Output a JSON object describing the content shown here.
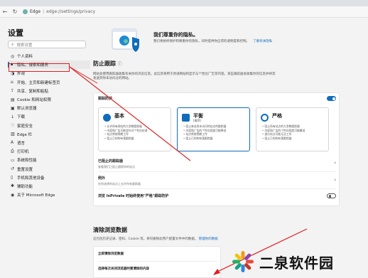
{
  "browser": {
    "brand": "Edge",
    "url": "edge://settings/privacy",
    "icons": [
      "back-icon",
      "refresh-icon",
      "edge-icon"
    ]
  },
  "sidebar": {
    "title": "设置",
    "search_placeholder": "搜索设置",
    "items": [
      {
        "label": "个人资料",
        "icon": "profile-icon"
      },
      {
        "label": "隐私、搜索和服务",
        "icon": "lock-icon",
        "active": true
      },
      {
        "label": "外观",
        "icon": "appearance-icon"
      },
      {
        "label": "开始、主页和新建标签页",
        "icon": "home-icon"
      },
      {
        "label": "共享、复制和粘贴",
        "icon": "share-icon"
      },
      {
        "label": "Cookie 和网站权限",
        "icon": "cookie-icon"
      },
      {
        "label": "默认浏览器",
        "icon": "browser-icon"
      },
      {
        "label": "下载",
        "icon": "download-icon"
      },
      {
        "label": "家庭安全",
        "icon": "family-icon"
      },
      {
        "label": "Edge 栏",
        "icon": "sidebar-icon"
      },
      {
        "label": "语言",
        "icon": "language-icon"
      },
      {
        "label": "打印机",
        "icon": "printer-icon"
      },
      {
        "label": "系统和性能",
        "icon": "system-icon"
      },
      {
        "label": "重置设置",
        "icon": "reset-icon"
      },
      {
        "label": "手机和其他设备",
        "icon": "phone-icon"
      },
      {
        "label": "辅助功能",
        "icon": "accessibility-icon"
      },
      {
        "label": "关于 Microsoft Edge",
        "icon": "edge-about-icon"
      }
    ]
  },
  "hero": {
    "title": "我们尊重你的隐私。",
    "subtitle": "我们将始终保护和尊重你的隐私，同时提供你应得的透明度和控制。",
    "link": "了解有关隐私"
  },
  "tracking": {
    "title": "防止跟踪",
    "description_line1": "网站会使用跟踪器收集有关你的浏览信息。此信息将用于改进网站和显示与个性化广告等内容。某些跟踪器会收集你的信息并将其",
    "description_line2": "发送到你未访问过的网站。",
    "toggle_label": "跟踪防护",
    "toggle_on": true,
    "cards": [
      {
        "name": "基本",
        "sub": "",
        "selected": false,
        "color": "#0f6cbd",
        "bullets": [
          "允许所有网站的大多数跟踪器",
          "内容和广告可能会针对个性化处理",
          "站点将按预期工作",
          "阻止已知的有害跟踪器"
        ]
      },
      {
        "name": "平衡",
        "sub": "(推荐)",
        "selected": true,
        "color": "#0f6cbd",
        "bullets": [
          "阻止来自尚未访问的站点的跟踪器",
          "内容和广告的个性化程度可能降低",
          "站点将按预期工作",
          "阻止已知的有害跟踪器"
        ]
      },
      {
        "name": "严格",
        "sub": "",
        "selected": false,
        "color": "#0f6cbd",
        "bullets": [
          "阻止所有站点的大多数跟踪器",
          "内容和广告的个性化程度可能最低",
          "部分站点可能无法工作",
          "阻止已知的有害跟踪器"
        ]
      }
    ],
    "rows": [
      {
        "title": "已阻止的跟踪器",
        "sub": "查看我们已阻止跟踪你的站点"
      },
      {
        "title": "例外",
        "sub": "在你选择的站点上允许所有跟踪器"
      }
    ],
    "inprivate_label": "浏览 InPrivate 时始终使用\"严格\"跟踪防护",
    "inprivate_on": false
  },
  "clear": {
    "title": "清除浏览数据",
    "description": "这包括历史记录、密码、Cookie 等。将仅删除此用户配置文件中的数据。",
    "link": "管理你的数据",
    "rows": [
      "立即清除浏览数据",
      "选择每次关闭浏览器时要清除的内容"
    ]
  },
  "watermark": {
    "text": "二泉软件园"
  }
}
